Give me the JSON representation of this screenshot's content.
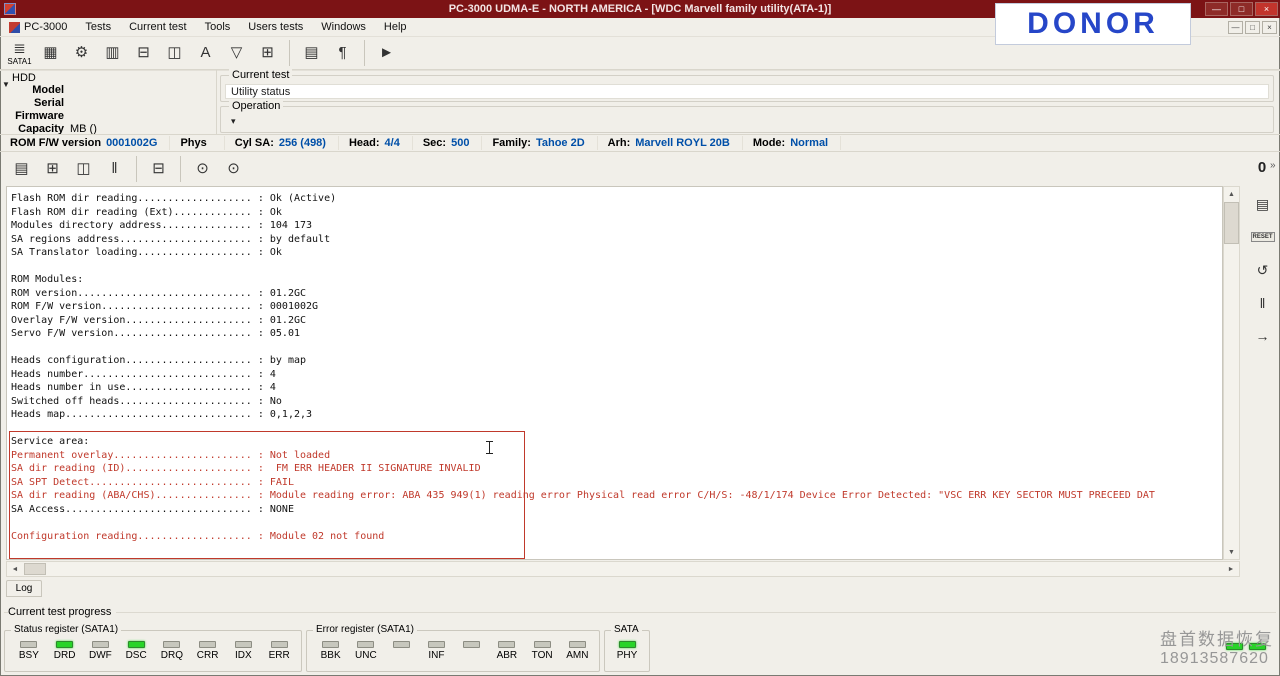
{
  "window": {
    "title": "PC-3000 UDMA-E - NORTH AMERICA - [WDC Marvell family utility(ATA-1)]",
    "minimize_glyph": "—",
    "maximize_glyph": "□",
    "close_glyph": "×"
  },
  "mdi_controls": {
    "minimize_glyph": "—",
    "restore_glyph": "□",
    "close_glyph": "×"
  },
  "donor_label": "DONOR",
  "menu": {
    "items": [
      "PC-3000",
      "Tests",
      "Current test",
      "Tools",
      "Users tests",
      "Windows",
      "Help"
    ]
  },
  "main_toolbar": {
    "icons": [
      {
        "name": "sata1-port-icon",
        "glyph": "≣",
        "label": "SATA1"
      },
      {
        "name": "pcb-board-icon",
        "glyph": "▦"
      },
      {
        "name": "gears-icon",
        "glyph": "⚙"
      },
      {
        "name": "memory-chip-icon",
        "glyph": "▥"
      },
      {
        "name": "file-copy-icon",
        "glyph": "⊟"
      },
      {
        "name": "disk-image-icon",
        "glyph": "◫"
      },
      {
        "name": "text-tool-icon",
        "glyph": "A"
      },
      {
        "name": "funnel-filter-icon",
        "glyph": "▽"
      },
      {
        "name": "sector-grid-icon",
        "glyph": "⊞"
      },
      {
        "sep": true
      },
      {
        "name": "copy-pages-icon",
        "glyph": "▤"
      },
      {
        "name": "script-icon",
        "glyph": "¶"
      },
      {
        "sep": true
      },
      {
        "name": "run-test-icon",
        "glyph": "►"
      }
    ]
  },
  "hdd_panel": {
    "title": "HDD",
    "collapse_glyph": "▼",
    "rows": [
      {
        "label": "Model",
        "suffix": ""
      },
      {
        "label": "Serial",
        "suffix": ""
      },
      {
        "label": "Firmware",
        "suffix": ""
      },
      {
        "label": "Capacity",
        "suffix": "MB ()"
      }
    ]
  },
  "test_panel": {
    "current_test_title": "Current test",
    "utility_status": "Utility status",
    "operation_title": "Operation",
    "operation_dropdown_glyph": "▾"
  },
  "info_bar": {
    "segments": [
      {
        "label": "ROM F/W version",
        "value": "0001002G"
      },
      {
        "label": "Phys",
        "value": ""
      },
      {
        "label": "Cyl SA:",
        "value": "256 (498)"
      },
      {
        "label": "Head:",
        "value": "4/4"
      },
      {
        "label": "Sec:",
        "value": "500"
      },
      {
        "label": "Family:",
        "value": "Tahoe 2D"
      },
      {
        "label": "Arh:",
        "value": "Marvell ROYL 20B"
      },
      {
        "label": "Mode:",
        "value": "Normal"
      }
    ]
  },
  "log_toolbar": {
    "icons": [
      {
        "name": "report-open-icon",
        "glyph": "▤"
      },
      {
        "name": "report-save-icon",
        "glyph": "⊞"
      },
      {
        "name": "save-log-icon",
        "glyph": "◫"
      },
      {
        "name": "pause-log-icon",
        "glyph": "‖"
      },
      {
        "sep": true
      },
      {
        "name": "copy-log-icon",
        "glyph": "⊟"
      },
      {
        "sep": true
      },
      {
        "name": "find-icon",
        "glyph": "⊙"
      },
      {
        "name": "find-next-icon",
        "glyph": "⊙"
      }
    ]
  },
  "right_toolbar": {
    "power_label": "0",
    "overflow_glyph": "»",
    "icons": [
      {
        "name": "terminal-icon",
        "glyph": "▤"
      },
      {
        "name": "reset-icon",
        "glyph": "RESET",
        "small": true
      },
      {
        "name": "recalibrate-icon",
        "glyph": "↺"
      },
      {
        "name": "pause-icon",
        "glyph": "‖"
      },
      {
        "name": "power-sequence-icon",
        "glyph": "→"
      }
    ]
  },
  "scrollbars": {
    "up": "▲",
    "down": "▼",
    "left": "◄",
    "right": "►"
  },
  "log": {
    "tab_label": "Log",
    "lines": [
      {
        "t": "Flash ROM dir reading................... : Ok (Active)",
        "c": "k"
      },
      {
        "t": "Flash ROM dir reading (Ext)............. : Ok",
        "c": "k"
      },
      {
        "t": "Modules directory address............... : 104 173",
        "c": "k"
      },
      {
        "t": "SA regions address...................... : by default",
        "c": "k"
      },
      {
        "t": "SA Translator loading................... : Ok",
        "c": "k"
      },
      {
        "t": "",
        "c": "k"
      },
      {
        "t": "ROM Modules:",
        "c": "k"
      },
      {
        "t": "ROM version............................. : 01.2GC",
        "c": "k"
      },
      {
        "t": "ROM F/W version......................... : 0001002G",
        "c": "k"
      },
      {
        "t": "Overlay F/W version..................... : 01.2GC",
        "c": "k"
      },
      {
        "t": "Servo F/W version....................... : 05.01",
        "c": "k"
      },
      {
        "t": "",
        "c": "k"
      },
      {
        "t": "Heads configuration..................... : by map",
        "c": "k"
      },
      {
        "t": "Heads number............................ : 4",
        "c": "k"
      },
      {
        "t": "Heads number in use..................... : 4",
        "c": "k"
      },
      {
        "t": "Switched off heads...................... : No",
        "c": "k"
      },
      {
        "t": "Heads map............................... : 0,1,2,3",
        "c": "k"
      },
      {
        "t": "",
        "c": "k"
      },
      {
        "t": "Service area:",
        "c": "k"
      },
      {
        "t": "Permanent overlay....................... : Not loaded",
        "c": "r"
      },
      {
        "t": "SA dir reading (ID)..................... :  FM ERR HEADER II SIGNATURE INVALID",
        "c": "r"
      },
      {
        "t": "SA SPT Detect........................... : FAIL",
        "c": "r"
      },
      {
        "t": "SA dir reading (ABA/CHS)................ : Module reading error: ABA 435 949(1) reading error Physical read error C/H/S: -48/1/174 Device Error Detected: \"VSC ERR KEY SECTOR MUST PRECEED DAT",
        "c": "r"
      },
      {
        "t": "SA Access............................... : NONE",
        "c": "k"
      },
      {
        "t": "",
        "c": "k"
      },
      {
        "t": "Configuration reading................... : Module 02 not found",
        "c": "r"
      }
    ]
  },
  "progress_label": "Current test progress",
  "registers": {
    "status": {
      "title": "Status register (SATA1)",
      "leds": [
        {
          "label": "BSY",
          "on": false
        },
        {
          "label": "DRD",
          "on": true
        },
        {
          "label": "DWF",
          "on": false
        },
        {
          "label": "DSC",
          "on": true
        },
        {
          "label": "DRQ",
          "on": false
        },
        {
          "label": "CRR",
          "on": false
        },
        {
          "label": "IDX",
          "on": false
        },
        {
          "label": "ERR",
          "on": false
        }
      ]
    },
    "error": {
      "title": "Error register (SATA1)",
      "leds": [
        {
          "label": "BBK",
          "on": false
        },
        {
          "label": "UNC",
          "on": false
        },
        {
          "label": "",
          "on": false
        },
        {
          "label": "INF",
          "on": false
        },
        {
          "label": "",
          "on": false
        },
        {
          "label": "ABR",
          "on": false
        },
        {
          "label": "TON",
          "on": false
        },
        {
          "label": "AMN",
          "on": false
        }
      ]
    },
    "sata": {
      "title": "SATA",
      "leds": [
        {
          "label": "PHY",
          "on": true
        }
      ]
    },
    "aux_leds": [
      {
        "label": "",
        "on": true
      },
      {
        "label": "",
        "on": true
      }
    ]
  },
  "watermark": {
    "line1": "盘首数据恢复",
    "line2": "18913587620"
  },
  "colors": {
    "titlebar": "#7c1315",
    "close_button": "#c2342c",
    "accent_blue": "#004fa8",
    "log_error_red": "#c0392b",
    "led_on_green": "#28d428",
    "donor_blue": "#2646c8"
  }
}
